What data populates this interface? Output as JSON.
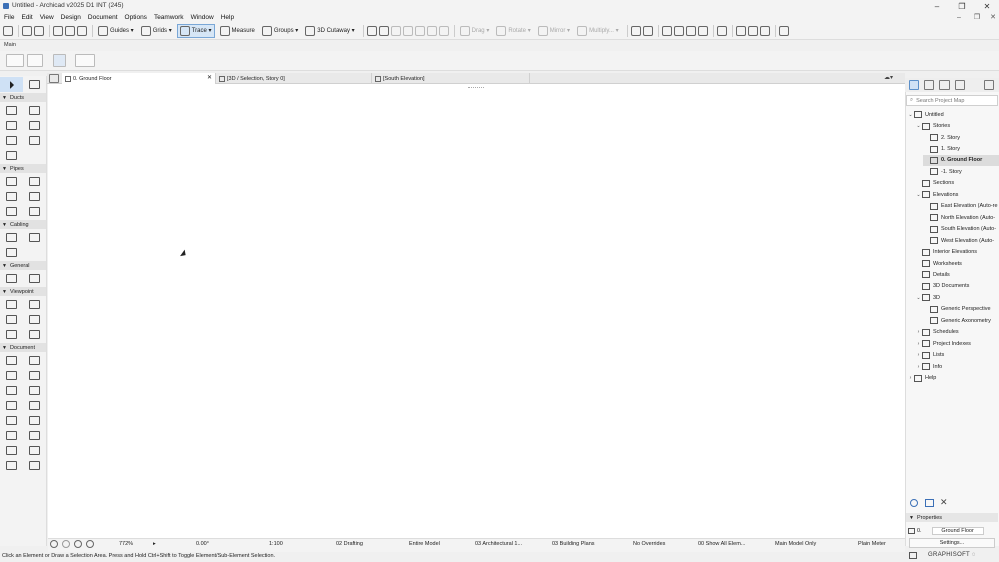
{
  "window": {
    "title": "Untitled - Archicad v2025 D1 INT (245)"
  },
  "menus": [
    "File",
    "Edit",
    "View",
    "Design",
    "Document",
    "Options",
    "Teamwork",
    "Window",
    "Help"
  ],
  "toolbar": {
    "guides": "Guides",
    "grids": "Grids",
    "trace": "Trace",
    "measure": "Measure",
    "groups": "Groups",
    "cutaway": "3D Cutaway",
    "drag": "Drag",
    "rotate": "Rotate",
    "mirror": "Mirror",
    "multiply": "Multiply..."
  },
  "main_label": "Main",
  "toolbox": {
    "sections": [
      "Ducts",
      "Pipes",
      "Cabling",
      "General",
      "Viewpoint",
      "Document"
    ]
  },
  "tabs": [
    {
      "label": "0. Ground Floor"
    },
    {
      "label": "[3D / Selection, Story 0]"
    },
    {
      "label": "[South Elevation]"
    }
  ],
  "statusbar": {
    "zoom": "772%",
    "angle": "0.00°",
    "scale": "1:100",
    "layer": "02 Drafting",
    "model": "Entire Model",
    "pen": "03 Architectural 1...",
    "mvo": "03 Building Plans",
    "overrides": "No Overrides",
    "show": "00 Show All Elem...",
    "model_only": "Main Model Only",
    "unit": "Plain Meter"
  },
  "hint": "Click an Element or Draw a Selection Area. Press and Hold Ctrl+Shift to Toggle Element/Sub-Element Selection.",
  "navigator": {
    "search_placeholder": "Search Project Map",
    "items": [
      {
        "label": "Untitled",
        "level": 0,
        "expander": "v"
      },
      {
        "label": "Stories",
        "level": 1,
        "expander": "v"
      },
      {
        "label": "2. Story",
        "level": 2,
        "expander": ""
      },
      {
        "label": "1. Story",
        "level": 2,
        "expander": ""
      },
      {
        "label": "0. Ground Floor",
        "level": 2,
        "expander": "",
        "selected": true
      },
      {
        "label": "-1. Story",
        "level": 2,
        "expander": ""
      },
      {
        "label": "Sections",
        "level": 1,
        "expander": ""
      },
      {
        "label": "Elevations",
        "level": 1,
        "expander": "v"
      },
      {
        "label": "East Elevation (Auto-re",
        "level": 2,
        "expander": ""
      },
      {
        "label": "North Elevation (Auto-",
        "level": 2,
        "expander": ""
      },
      {
        "label": "South Elevation (Auto-",
        "level": 2,
        "expander": ""
      },
      {
        "label": "West Elevation (Auto-",
        "level": 2,
        "expander": ""
      },
      {
        "label": "Interior Elevations",
        "level": 1,
        "expander": ""
      },
      {
        "label": "Worksheets",
        "level": 1,
        "expander": ""
      },
      {
        "label": "Details",
        "level": 1,
        "expander": ""
      },
      {
        "label": "3D Documents",
        "level": 1,
        "expander": ""
      },
      {
        "label": "3D",
        "level": 1,
        "expander": "v"
      },
      {
        "label": "Generic Perspective",
        "level": 2,
        "expander": ""
      },
      {
        "label": "Generic Axonometry",
        "level": 2,
        "expander": ""
      },
      {
        "label": "Schedules",
        "level": 1,
        "expander": ">"
      },
      {
        "label": "Project Indexes",
        "level": 1,
        "expander": ">"
      },
      {
        "label": "Lists",
        "level": 1,
        "expander": ">"
      },
      {
        "label": "Info",
        "level": 1,
        "expander": ">"
      },
      {
        "label": "Help",
        "level": 0,
        "expander": ">"
      }
    ]
  },
  "properties": {
    "header": "Properties",
    "id": "0.",
    "name": "Ground Floor",
    "settings": "Settings..."
  },
  "brand": "GRAPHISOFT"
}
